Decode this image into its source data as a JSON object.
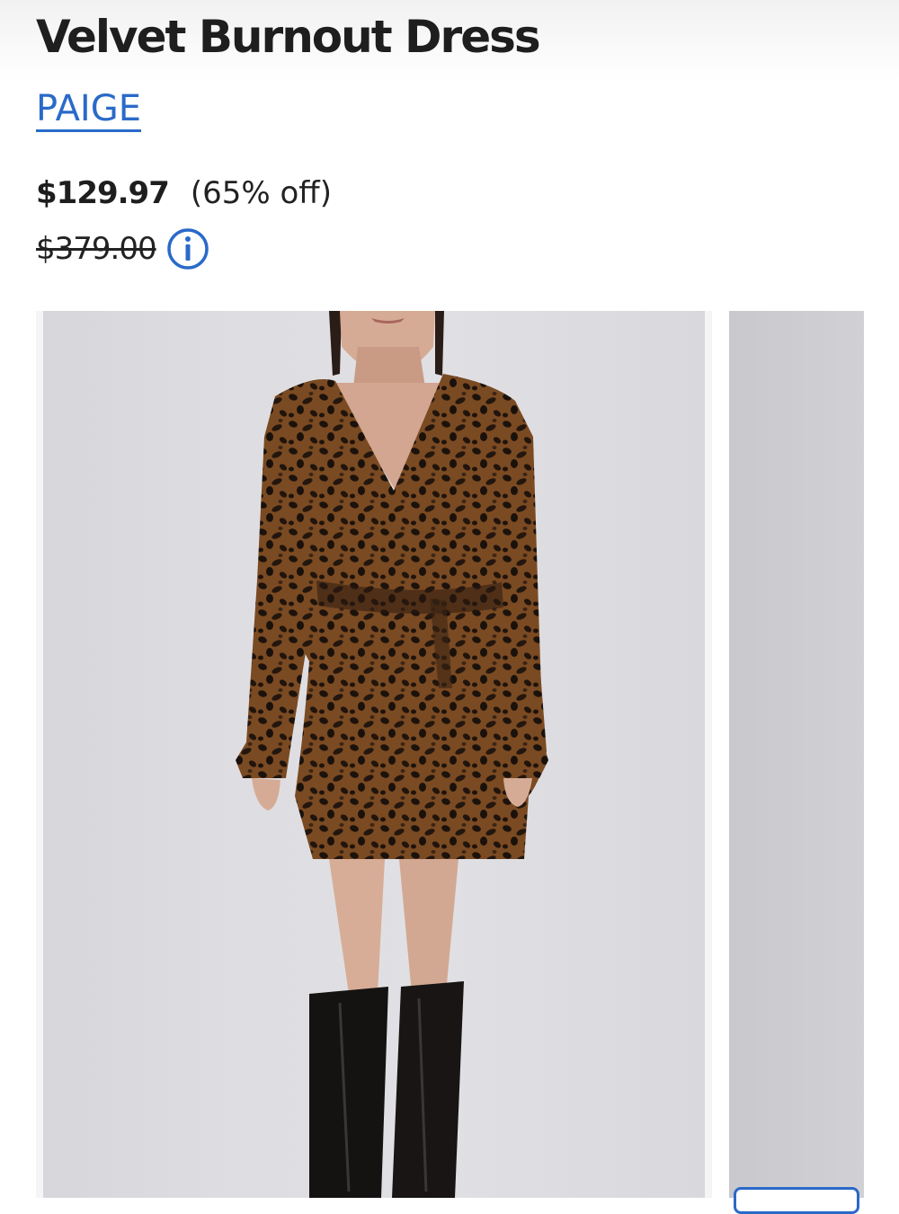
{
  "product": {
    "title": "Velvet Burnout Dress",
    "brand": "PAIGE",
    "price": {
      "current": "$129.97",
      "discount": "(65% off)",
      "original": "$379.00"
    }
  },
  "colors": {
    "brand_link": "#2a6ac9",
    "image_background": "#dedee2"
  },
  "icons": {
    "price_info": "info-circle-icon"
  },
  "gallery": {
    "images": [
      {
        "subject": "model wearing leopard print velvet burnout wrap dress with knee-high black boots"
      },
      {
        "subject": "next product image (partially visible)"
      }
    ]
  }
}
